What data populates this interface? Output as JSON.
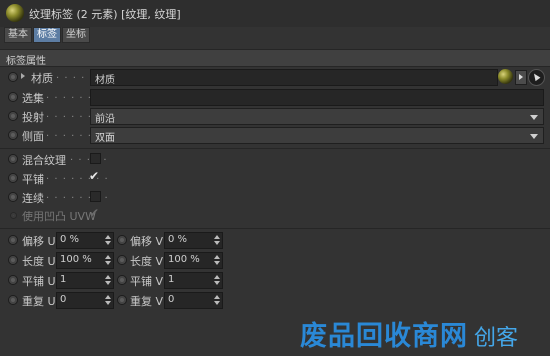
{
  "window": {
    "title": "纹理标签 (2 元素) [纹理, 纹理]",
    "icon": "material-sphere-icon"
  },
  "tabs": [
    {
      "label": "基本",
      "active": false
    },
    {
      "label": "标签",
      "active": true
    },
    {
      "label": "坐标",
      "active": false
    }
  ],
  "section": {
    "title": "标签属性"
  },
  "props": {
    "material": {
      "label": "材质",
      "dots": ". . . . . . .",
      "value": "材质"
    },
    "selection": {
      "label": "选集",
      "dots": ". . . . . . . . .",
      "value": ""
    },
    "projection": {
      "label": "投射",
      "dots": ". . . . . . . . .",
      "value": "前沿"
    },
    "side": {
      "label": "侧面",
      "dots": ". . . . . . . . .",
      "value": "双面"
    }
  },
  "options": {
    "mix": {
      "label": "混合纹理",
      "dots": ". . . . .",
      "checked": false
    },
    "tile": {
      "label": "平铺",
      "dots": ". . . . . . . .",
      "checked": true
    },
    "seamless": {
      "label": "连续",
      "dots": ". . . . . . . .",
      "checked": false
    },
    "bump_uvw": {
      "label": "使用凹凸 UVW",
      "checked": true,
      "disabled": true
    }
  },
  "uv_params": {
    "offset_u": {
      "label": "偏移 U",
      "value": "0 %"
    },
    "offset_v": {
      "label": "偏移 V",
      "value": "0 %"
    },
    "length_u": {
      "label": "长度 U",
      "value": "100 %"
    },
    "length_v": {
      "label": "长度 V",
      "value": "100 %"
    },
    "tiles_u": {
      "label": "平铺 U",
      "value": "1"
    },
    "tiles_v": {
      "label": "平铺 V",
      "value": "1"
    },
    "repeat_u": {
      "label": "重复 U",
      "value": "0"
    },
    "repeat_v": {
      "label": "重复 V",
      "value": "0"
    }
  },
  "watermark": {
    "text": "废品回收商网",
    "sub": "创客"
  },
  "colors": {
    "active_tab": "#5d7da3",
    "background": "#333333",
    "field": "#262626"
  }
}
